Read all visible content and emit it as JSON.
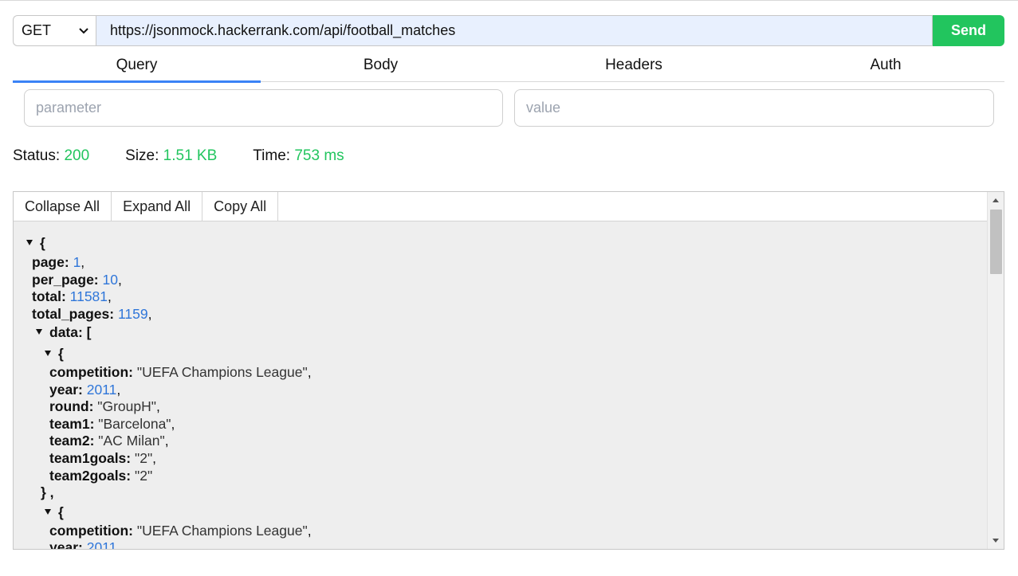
{
  "request": {
    "method": "GET",
    "url": "https://jsonmock.hackerrank.com/api/football_matches",
    "send_label": "Send"
  },
  "tabs": [
    {
      "label": "Query",
      "active": true
    },
    {
      "label": "Body",
      "active": false
    },
    {
      "label": "Headers",
      "active": false
    },
    {
      "label": "Auth",
      "active": false
    }
  ],
  "query": {
    "parameter_placeholder": "parameter",
    "value_placeholder": "value"
  },
  "status": {
    "status_label": "Status:",
    "status_value": "200",
    "size_label": "Size:",
    "size_value": "1.51 KB",
    "time_label": "Time:",
    "time_value": "753 ms"
  },
  "toolbar": {
    "collapse_label": "Collapse All",
    "expand_label": "Expand All",
    "copy_label": "Copy All"
  },
  "json": {
    "open_brace": "{",
    "page_key": "page:",
    "page_val": "1",
    "per_page_key": "per_page:",
    "per_page_val": "10",
    "total_key": "total:",
    "total_val": "11581",
    "total_pages_key": "total_pages:",
    "total_pages_val": "1159",
    "data_key": "data: [",
    "close_item": "} ,",
    "items": [
      {
        "competition": "\"UEFA Champions League\"",
        "year": "2011",
        "round": "\"GroupH\"",
        "team1": "\"Barcelona\"",
        "team2": "\"AC Milan\"",
        "team1goals": "\"2\"",
        "team2goals": "\"2\""
      },
      {
        "competition": "\"UEFA Champions League\"",
        "year": "2011"
      }
    ]
  },
  "colors": {
    "accent": "#3b82f6",
    "success": "#22c55e",
    "number": "#2f76d9",
    "url_bg": "#e8f0fe"
  }
}
